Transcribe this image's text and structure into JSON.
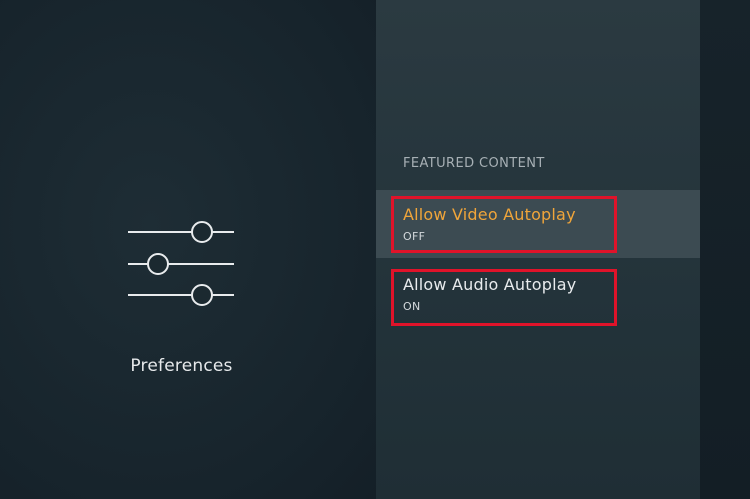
{
  "left_panel": {
    "label": "Preferences",
    "icon": "sliders-icon"
  },
  "section": {
    "heading": "FEATURED CONTENT"
  },
  "items": [
    {
      "title": "Allow Video Autoplay",
      "value": "OFF",
      "selected": true
    },
    {
      "title": "Allow Audio Autoplay",
      "value": "ON",
      "selected": false
    }
  ],
  "colors": {
    "accent": "#f0a53a",
    "highlight_box": "#e0132a",
    "selected_row": "#3c4b52"
  }
}
